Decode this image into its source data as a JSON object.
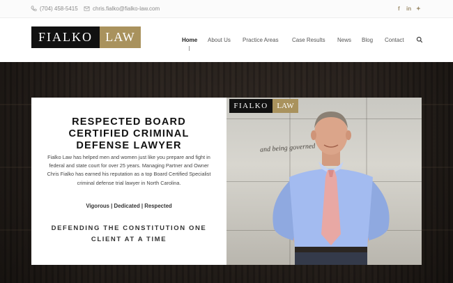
{
  "topbar": {
    "phone": "(704) 458-5415",
    "email": "chris.fialko@fialko-law.com",
    "social": [
      {
        "icon": "facebook-icon",
        "glyph": "f"
      },
      {
        "icon": "linkedin-icon",
        "glyph": "in"
      },
      {
        "icon": "twitter-icon",
        "glyph": "✦"
      }
    ]
  },
  "logo": {
    "left": "FIALKO",
    "right": "LAW"
  },
  "nav": {
    "items": [
      "Home",
      "About Us",
      "Practice Areas",
      "Case Results",
      "News",
      "Blog",
      "Contact"
    ],
    "active": "Home"
  },
  "hero": {
    "title": "RESPECTED BOARD CERTIFIED CRIMINAL DEFENSE LAWYER",
    "body": "Fialko Law has helped men and women just like you prepare and fight in federal and state court for over 25 years. Managing Partner and Owner Chris Fialko has earned his reputation as a top Board Certified Specialist criminal defense trial lawyer in North Carolina.",
    "tagline": "Vigorous | Dedicated | Respected",
    "motto": "DEFENDING THE CONSTITUTION ONE CLIENT AT A TIME",
    "photo_logo": {
      "left": "FIALKO",
      "right": "LAW"
    },
    "engraved_text": "and being governed"
  },
  "colors": {
    "brand_gold": "#a9925d",
    "brand_black": "#111111"
  }
}
